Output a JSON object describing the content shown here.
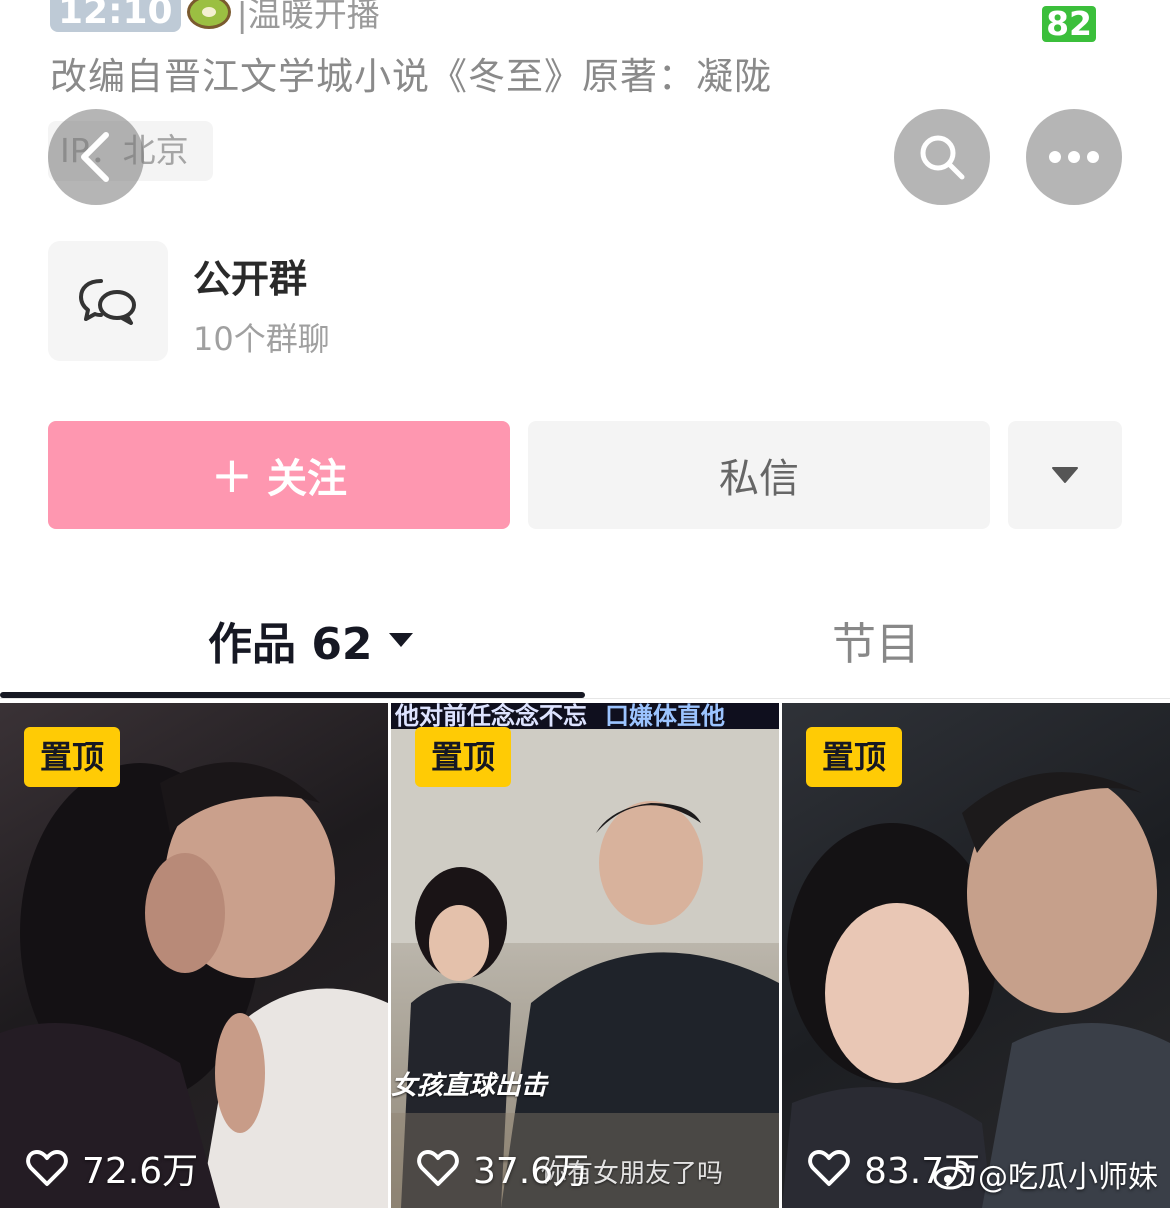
{
  "header": {
    "time_text": "12:10",
    "top_text": "|温暖开播",
    "battery": "82"
  },
  "profile": {
    "bio": "改编自晋江文学城小说《冬至》原著：凝陇",
    "ip_label": "IP：北京"
  },
  "group": {
    "title": "公开群",
    "subtitle": "10个群聊"
  },
  "actions": {
    "follow_plus": "+",
    "follow_label": "关注",
    "message_label": "私信"
  },
  "tabs": {
    "works_label": "作品 62",
    "programs_label": "节目"
  },
  "videos": [
    {
      "pinned_label": "置顶",
      "likes": "72.6万"
    },
    {
      "pinned_label": "置顶",
      "likes": "37.6万",
      "banner_left": "他对前任念念不忘",
      "banner_right": "口嫌体直他",
      "caption_left": "女孩直球出击",
      "caption_bottom": "你有女朋友了吗"
    },
    {
      "pinned_label": "置顶",
      "likes": "83.7万"
    }
  ],
  "watermark": "@吃瓜小师妹",
  "colors": {
    "follow": "#fe97b0",
    "pin": "#ffcb05",
    "battery": "#3bbf3b"
  }
}
